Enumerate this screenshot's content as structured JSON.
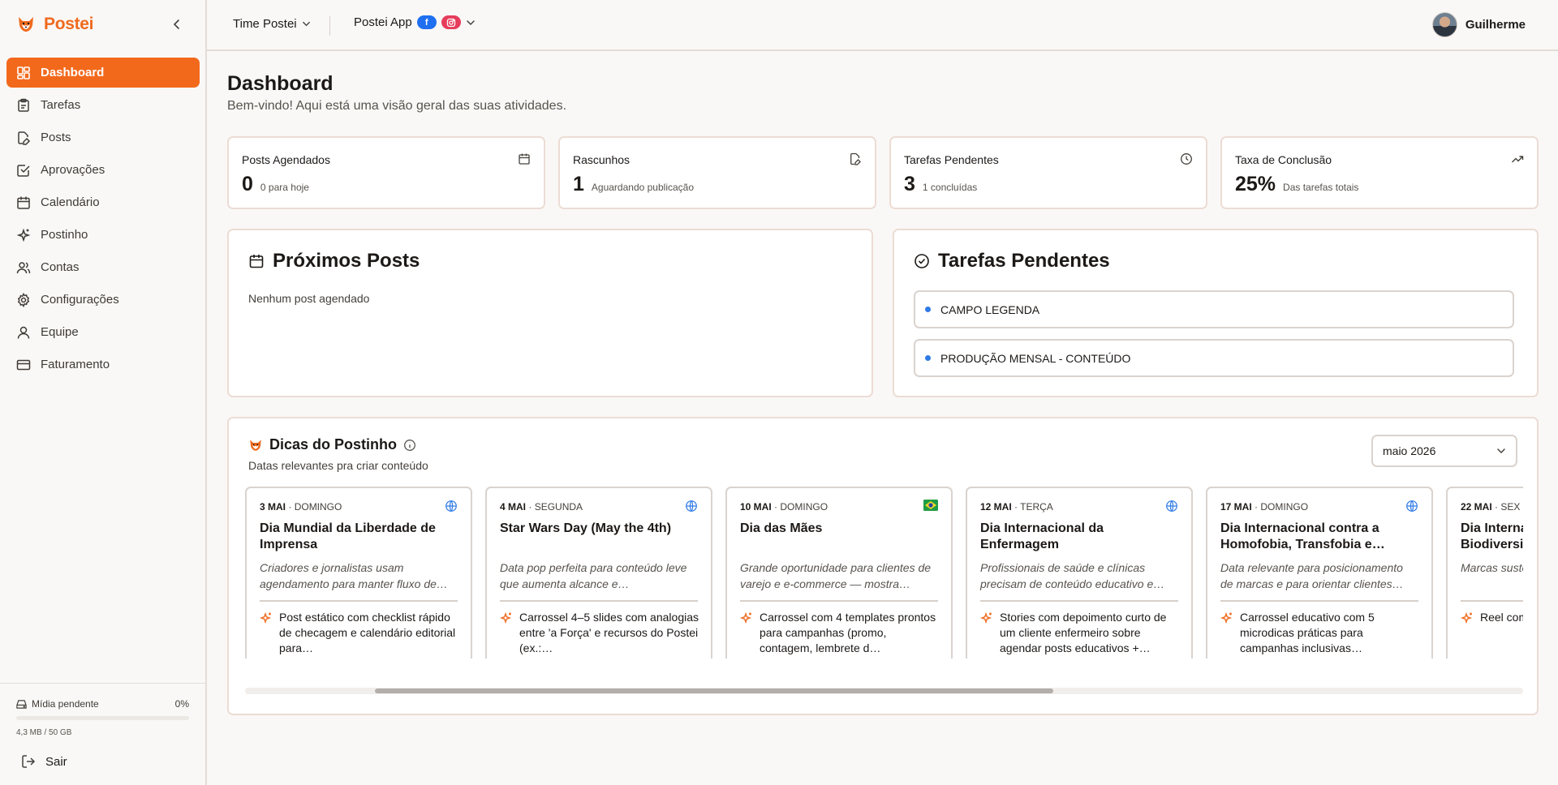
{
  "brand": {
    "name": "Postei"
  },
  "sidebar": {
    "items": [
      {
        "label": "Dashboard",
        "icon": "dashboard-icon",
        "active": true
      },
      {
        "label": "Tarefas",
        "icon": "clipboard-icon"
      },
      {
        "label": "Posts",
        "icon": "file-pen-icon"
      },
      {
        "label": "Aprovações",
        "icon": "check-square-icon"
      },
      {
        "label": "Calendário",
        "icon": "calendar-icon"
      },
      {
        "label": "Postinho",
        "icon": "sparkles-icon"
      },
      {
        "label": "Contas",
        "icon": "users-icon"
      },
      {
        "label": "Configurações",
        "icon": "gear-icon"
      },
      {
        "label": "Equipe",
        "icon": "user-icon"
      },
      {
        "label": "Faturamento",
        "icon": "credit-card-icon"
      }
    ],
    "storage": {
      "label": "Mídia pendente",
      "percent_label": "0%",
      "percent": 0,
      "size": "4,3 MB / 50 GB"
    },
    "logout_label": "Sair"
  },
  "topbar": {
    "team": "Time Postei",
    "app": "Postei App",
    "user": "Guilherme"
  },
  "header": {
    "title": "Dashboard",
    "subtitle": "Bem-vindo! Aqui está uma visão geral das suas atividades."
  },
  "stats": [
    {
      "label": "Posts Agendados",
      "value": "0",
      "hint": "0 para hoje",
      "icon": "calendar-icon"
    },
    {
      "label": "Rascunhos",
      "value": "1",
      "hint": "Aguardando publicação",
      "icon": "file-pen-icon"
    },
    {
      "label": "Tarefas Pendentes",
      "value": "3",
      "hint": "1 concluídas",
      "icon": "clock-icon"
    },
    {
      "label": "Taxa de Conclusão",
      "value": "25%",
      "hint": "Das tarefas totais",
      "icon": "trending-up-icon"
    }
  ],
  "upcoming": {
    "title": "Próximos Posts",
    "empty": "Nenhum post agendado"
  },
  "pending": {
    "title": "Tarefas Pendentes",
    "tasks": [
      "CAMPO LEGENDA",
      "PRODUÇÃO MENSAL - CONTEÚDO"
    ]
  },
  "tips": {
    "title": "Dicas do Postinho",
    "subtitle": "Datas relevantes pra criar conteúdo",
    "month": "maio 2026",
    "cards": [
      {
        "date": "3 MAI",
        "weekday": "· DOMINGO",
        "flag": "globe-icon",
        "title": "Dia Mundial da Liberdade de Imprensa",
        "desc": "Criadores e jornalistas usam agendamento para manter fluxo de…",
        "idea": "Post estático com checklist rápido de checagem e calendário editorial para…"
      },
      {
        "date": "4 MAI",
        "weekday": "· SEGUNDA",
        "flag": "globe-icon",
        "title": "Star Wars Day (May the 4th)",
        "desc": "Data pop perfeita para conteúdo leve que aumenta alcance e…",
        "idea": "Carrossel 4–5 slides com analogias entre 'a Força' e recursos do Postei (ex.:…"
      },
      {
        "date": "10 MAI",
        "weekday": "· DOMINGO",
        "flag": "brazil-flag-icon",
        "title": "Dia das Mães",
        "desc": "Grande oportunidade para clientes de varejo e e-commerce — mostra…",
        "idea": "Carrossel com 4 templates prontos para campanhas (promo, contagem, lembrete d…"
      },
      {
        "date": "12 MAI",
        "weekday": "· TERÇA",
        "flag": "globe-icon",
        "title": "Dia Internacional da Enfermagem",
        "desc": "Profissionais de saúde e clínicas precisam de conteúdo educativo e…",
        "idea": "Stories com depoimento curto de um cliente enfermeiro sobre agendar posts educativos +…"
      },
      {
        "date": "17 MAI",
        "weekday": "· DOMINGO",
        "flag": "globe-icon",
        "title": "Dia Internacional contra a Homofobia, Transfobia e…",
        "desc": "Data relevante para posicionamento de marcas e para orientar clientes…",
        "idea": "Carrossel educativo com 5 microdicas práticas para campanhas inclusivas…"
      },
      {
        "date": "22 MAI",
        "weekday": "· SEX",
        "flag": "globe-icon",
        "title": "Dia Internacional da Biodiversidade",
        "desc": "Marcas sustentáveis costumam…",
        "idea": "Reel com… e agend… usando…"
      }
    ]
  },
  "colors": {
    "accent": "#f2691c",
    "task_dot": "#2f7ae5",
    "facebook": "#1f6ff0",
    "instagram": "#e63d5c"
  }
}
